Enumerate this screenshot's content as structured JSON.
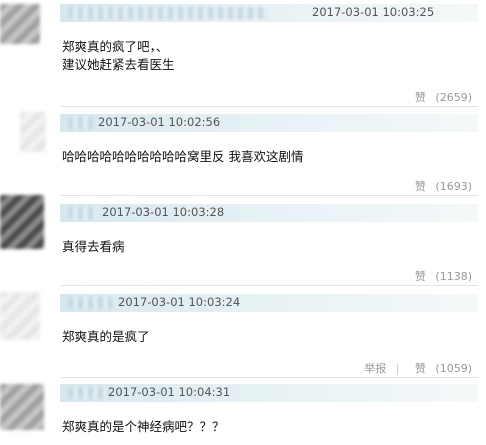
{
  "comments": [
    {
      "timestamp": "2017-03-01 10:03:25",
      "text_lines": [
        "郑爽真的疯了吧，、",
        "建议她赶紧去看医生"
      ],
      "like_label": "赞",
      "like_count": "(2659)"
    },
    {
      "timestamp": "2017-03-01 10:02:56",
      "text_lines": [
        "哈哈哈哈哈哈哈哈哈哈窝里反 我喜欢这剧情"
      ],
      "like_label": "赞",
      "like_count": "(1693)"
    },
    {
      "timestamp": "2017-03-01 10:03:28",
      "text_lines": [
        "真得去看病"
      ],
      "like_label": "赞",
      "like_count": "(1138)"
    },
    {
      "timestamp": "2017-03-01 10:03:24",
      "text_lines": [
        "郑爽真的是疯了"
      ],
      "report_label": "举报",
      "like_label": "赞",
      "like_count": "(1059)"
    },
    {
      "timestamp": "2017-03-01 10:04:31",
      "text_lines": [
        "郑爽真的是个神经病吧？？？"
      ]
    }
  ],
  "colors": {
    "meta_bar": "#d7e8ee",
    "text": "#111111",
    "muted": "#999999"
  }
}
